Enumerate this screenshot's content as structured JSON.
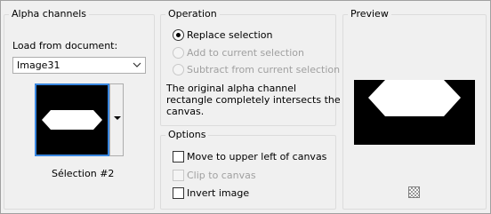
{
  "alpha_channels": {
    "title": "Alpha channels",
    "load_label": "Load from document:",
    "document_value": "Image31",
    "selection_name": "Sélection #2"
  },
  "operation": {
    "title": "Operation",
    "options": [
      {
        "label": "Replace selection",
        "checked": true,
        "enabled": true
      },
      {
        "label": "Add to current selection",
        "checked": false,
        "enabled": false
      },
      {
        "label": "Subtract from current selection",
        "checked": false,
        "enabled": false
      }
    ],
    "info_line1": "The original alpha channel",
    "info_line2": "rectangle completely intersects the",
    "info_line3": "canvas."
  },
  "options": {
    "title": "Options",
    "items": [
      {
        "label": "Move to upper left of canvas",
        "checked": false,
        "enabled": true
      },
      {
        "label": "Clip to canvas",
        "checked": false,
        "enabled": false
      },
      {
        "label": "Invert image",
        "checked": false,
        "enabled": true
      }
    ]
  },
  "preview": {
    "title": "Preview"
  },
  "icons": {
    "dropdown": "chevron-down-icon",
    "thumbnail_menu": "arrow-down-icon",
    "background_toggle": "checkerboard-icon"
  },
  "colors": {
    "accent": "#3a87e0",
    "disabled_text": "#a0a0a0"
  }
}
